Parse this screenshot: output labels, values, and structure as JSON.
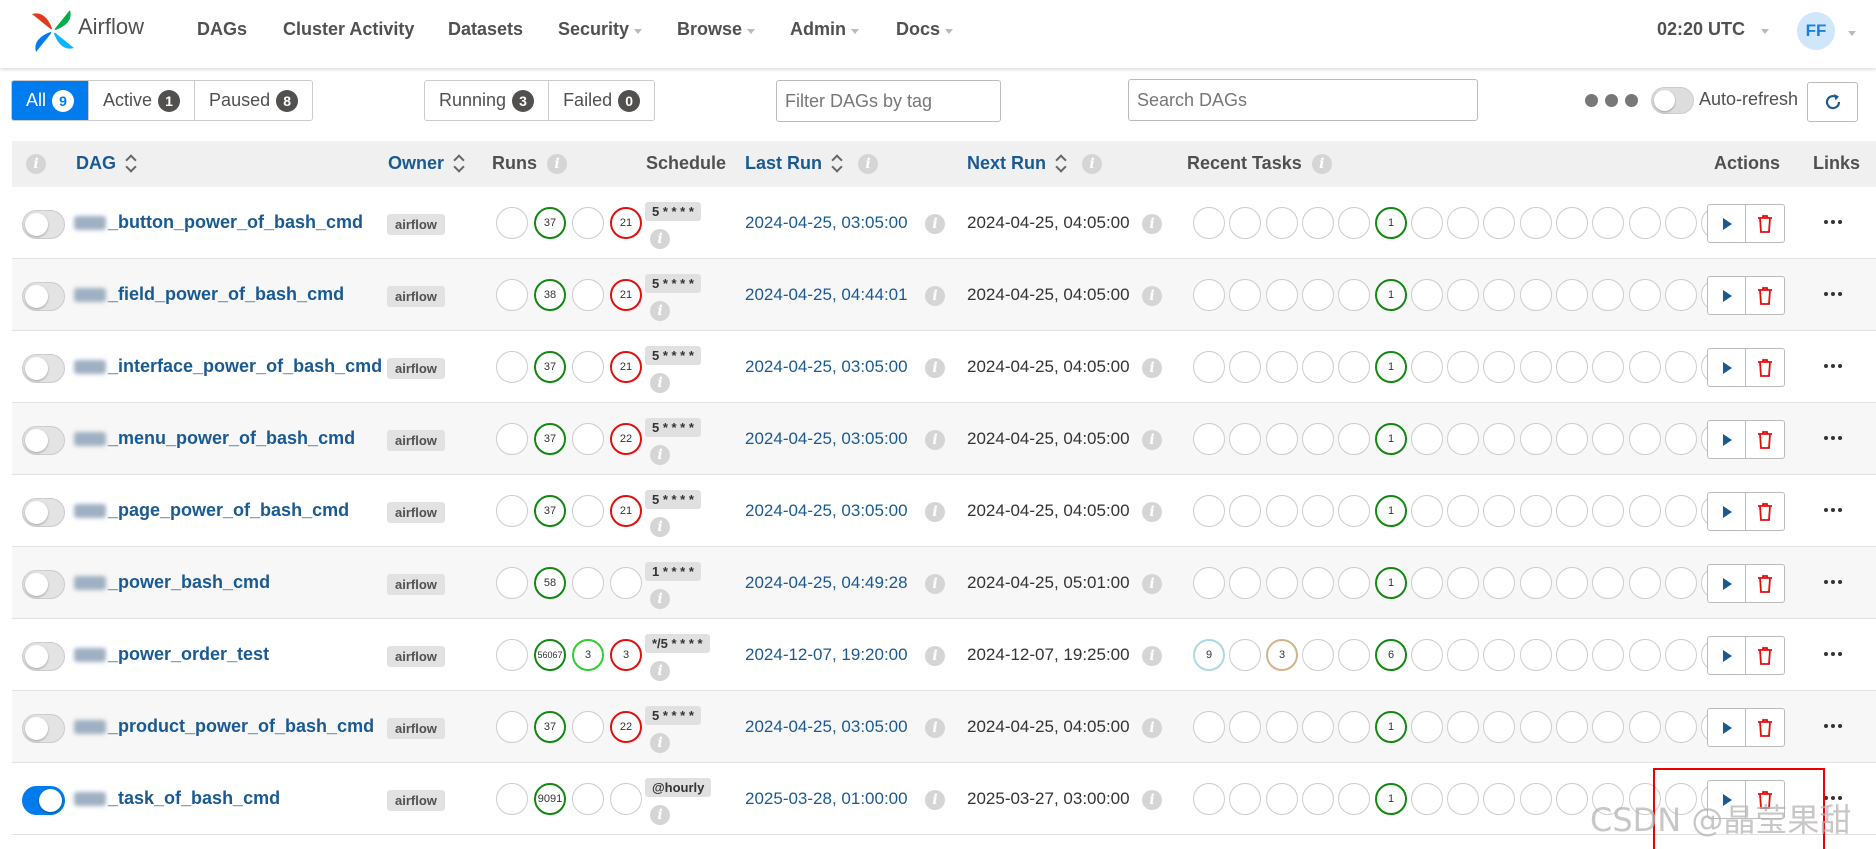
{
  "navbar": {
    "brand": "Airflow",
    "items": [
      {
        "label": "DAGs",
        "dropdown": false
      },
      {
        "label": "Cluster Activity",
        "dropdown": false
      },
      {
        "label": "Datasets",
        "dropdown": false
      },
      {
        "label": "Security",
        "dropdown": true
      },
      {
        "label": "Browse",
        "dropdown": true
      },
      {
        "label": "Admin",
        "dropdown": true
      },
      {
        "label": "Docs",
        "dropdown": true
      }
    ],
    "clock": "02:20 UTC",
    "user_initials": "FF"
  },
  "filters": {
    "status": [
      {
        "label": "All",
        "count": "9",
        "active": true
      },
      {
        "label": "Active",
        "count": "1",
        "active": false
      },
      {
        "label": "Paused",
        "count": "8",
        "active": false
      }
    ],
    "runs": [
      {
        "label": "Running",
        "count": "3"
      },
      {
        "label": "Failed",
        "count": "0"
      }
    ],
    "tag_placeholder": "Filter DAGs by tag",
    "search_placeholder": "Search DAGs",
    "auto_refresh_label": "Auto-refresh"
  },
  "table": {
    "headers": {
      "dag": "DAG",
      "owner": "Owner",
      "runs": "Runs",
      "schedule": "Schedule",
      "last_run": "Last Run",
      "next_run": "Next Run",
      "recent_tasks": "Recent Tasks",
      "actions": "Actions",
      "links": "Links"
    },
    "rows": [
      {
        "name": "_button_power_of_bash_cmd",
        "active": false,
        "owner": "airflow",
        "runs": [
          {
            "v": "",
            "c": ""
          },
          {
            "v": "37",
            "c": "green"
          },
          {
            "v": "",
            "c": ""
          },
          {
            "v": "21",
            "c": "red"
          }
        ],
        "schedule": "5 * * * *",
        "last_run": "2024-04-25, 03:05:00",
        "next_run": "2024-04-25, 04:05:00",
        "tasks": [
          {
            "i": 5,
            "v": "1",
            "c": "green"
          }
        ]
      },
      {
        "name": "_field_power_of_bash_cmd",
        "active": false,
        "owner": "airflow",
        "runs": [
          {
            "v": "",
            "c": ""
          },
          {
            "v": "38",
            "c": "green"
          },
          {
            "v": "",
            "c": ""
          },
          {
            "v": "21",
            "c": "red"
          }
        ],
        "schedule": "5 * * * *",
        "last_run": "2024-04-25, 04:44:01",
        "next_run": "2024-04-25, 04:05:00",
        "tasks": [
          {
            "i": 5,
            "v": "1",
            "c": "green"
          }
        ]
      },
      {
        "name": "_interface_power_of_bash_cmd",
        "active": false,
        "owner": "airflow",
        "runs": [
          {
            "v": "",
            "c": ""
          },
          {
            "v": "37",
            "c": "green"
          },
          {
            "v": "",
            "c": ""
          },
          {
            "v": "21",
            "c": "red"
          }
        ],
        "schedule": "5 * * * *",
        "last_run": "2024-04-25, 03:05:00",
        "next_run": "2024-04-25, 04:05:00",
        "tasks": [
          {
            "i": 5,
            "v": "1",
            "c": "green"
          }
        ]
      },
      {
        "name": "_menu_power_of_bash_cmd",
        "active": false,
        "owner": "airflow",
        "runs": [
          {
            "v": "",
            "c": ""
          },
          {
            "v": "37",
            "c": "green"
          },
          {
            "v": "",
            "c": ""
          },
          {
            "v": "22",
            "c": "red"
          }
        ],
        "schedule": "5 * * * *",
        "last_run": "2024-04-25, 03:05:00",
        "next_run": "2024-04-25, 04:05:00",
        "tasks": [
          {
            "i": 5,
            "v": "1",
            "c": "green"
          }
        ]
      },
      {
        "name": "_page_power_of_bash_cmd",
        "active": false,
        "owner": "airflow",
        "runs": [
          {
            "v": "",
            "c": ""
          },
          {
            "v": "37",
            "c": "green"
          },
          {
            "v": "",
            "c": ""
          },
          {
            "v": "21",
            "c": "red"
          }
        ],
        "schedule": "5 * * * *",
        "last_run": "2024-04-25, 03:05:00",
        "next_run": "2024-04-25, 04:05:00",
        "tasks": [
          {
            "i": 5,
            "v": "1",
            "c": "green"
          }
        ]
      },
      {
        "name": "_power_bash_cmd",
        "active": false,
        "owner": "airflow",
        "runs": [
          {
            "v": "",
            "c": ""
          },
          {
            "v": "58",
            "c": "green"
          },
          {
            "v": "",
            "c": ""
          },
          {
            "v": "",
            "c": ""
          }
        ],
        "schedule": "1 * * * *",
        "last_run": "2024-04-25, 04:49:28",
        "next_run": "2024-04-25, 05:01:00",
        "tasks": [
          {
            "i": 5,
            "v": "1",
            "c": "green"
          }
        ]
      },
      {
        "name": "_power_order_test",
        "active": false,
        "owner": "airflow",
        "runs": [
          {
            "v": "",
            "c": ""
          },
          {
            "v": "56067",
            "c": "green"
          },
          {
            "v": "3",
            "c": "lime"
          },
          {
            "v": "3",
            "c": "red"
          }
        ],
        "schedule": "*/5 * * * *",
        "last_run": "2024-12-07, 19:20:00",
        "next_run": "2024-12-07, 19:25:00",
        "tasks": [
          {
            "i": 0,
            "v": "9",
            "c": "lightblue"
          },
          {
            "i": 2,
            "v": "3",
            "c": "tan"
          },
          {
            "i": 5,
            "v": "6",
            "c": "green"
          }
        ]
      },
      {
        "name": "_product_power_of_bash_cmd",
        "active": false,
        "owner": "airflow",
        "runs": [
          {
            "v": "",
            "c": ""
          },
          {
            "v": "37",
            "c": "green"
          },
          {
            "v": "",
            "c": ""
          },
          {
            "v": "22",
            "c": "red"
          }
        ],
        "schedule": "5 * * * *",
        "last_run": "2024-04-25, 03:05:00",
        "next_run": "2024-04-25, 04:05:00",
        "tasks": [
          {
            "i": 5,
            "v": "1",
            "c": "green"
          }
        ]
      },
      {
        "name": "_task_of_bash_cmd",
        "active": true,
        "owner": "airflow",
        "runs": [
          {
            "v": "",
            "c": ""
          },
          {
            "v": "9091",
            "c": "green"
          },
          {
            "v": "",
            "c": ""
          },
          {
            "v": "",
            "c": ""
          }
        ],
        "schedule": "@hourly",
        "last_run": "2025-03-28, 01:00:00",
        "next_run": "2025-03-27, 03:00:00",
        "tasks": [
          {
            "i": 5,
            "v": "1",
            "c": "green"
          }
        ]
      }
    ]
  },
  "watermark": "CSDN @晶莹果甜",
  "colors": {
    "primary": "#017cee",
    "success": "#128712",
    "failed": "#e30e0e",
    "running": "#32cd32",
    "queued": "#add8e6",
    "scheduled": "#d2b48c"
  }
}
